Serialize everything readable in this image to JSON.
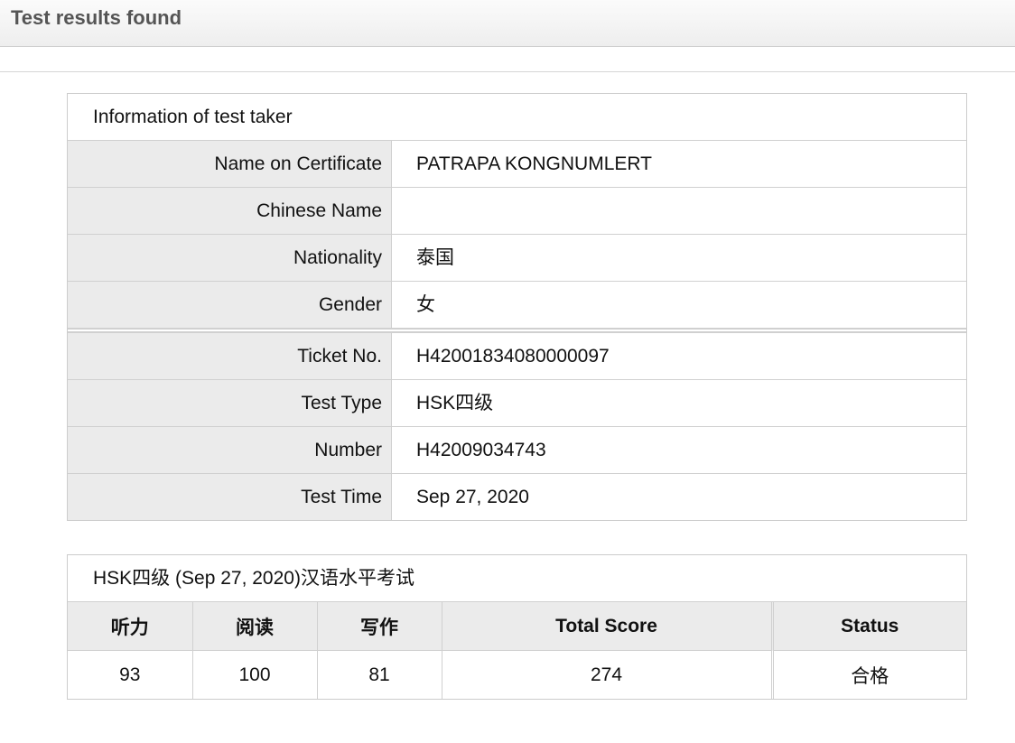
{
  "header": {
    "title": "Test results found"
  },
  "info": {
    "title": "Information of test taker",
    "rows": [
      {
        "label": "Name on Certificate",
        "value": "PATRAPA KONGNUMLERT"
      },
      {
        "label": "Chinese Name",
        "value": ""
      },
      {
        "label": "Nationality",
        "value": "泰国"
      },
      {
        "label": "Gender",
        "value": "女"
      }
    ],
    "exam_rows": [
      {
        "label": "Ticket No.",
        "value": "H42001834080000097"
      },
      {
        "label": "Test Type",
        "value": "HSK四级"
      },
      {
        "label": "Number",
        "value": "H42009034743"
      },
      {
        "label": "Test Time",
        "value": "Sep 27, 2020"
      }
    ]
  },
  "scores": {
    "title": "HSK四级 (Sep 27, 2020)汉语水平考试",
    "headers": [
      "听力",
      "阅读",
      "写作",
      "Total Score",
      "Status"
    ],
    "values": [
      "93",
      "100",
      "81",
      "274",
      "合格"
    ]
  }
}
